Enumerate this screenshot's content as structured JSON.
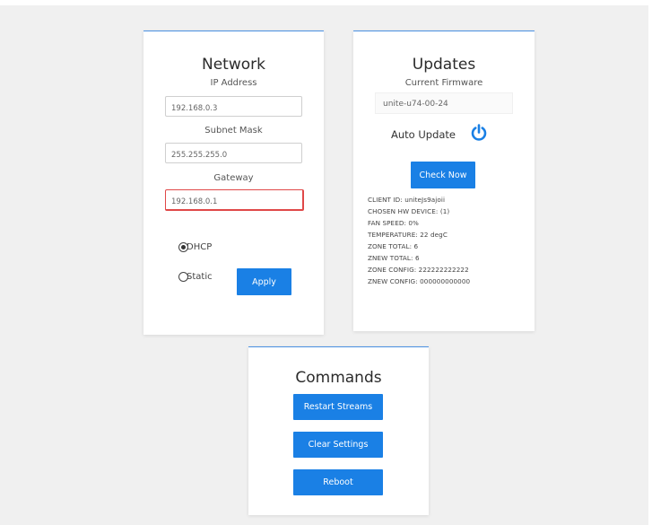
{
  "network": {
    "title": "Network",
    "ip_label": "IP Address",
    "ip_value": "192.168.0.3",
    "subnet_label": "Subnet Mask",
    "subnet_value": "255.255.255.0",
    "gateway_label": "Gateway",
    "gateway_value": "192.168.0.1",
    "dhcp_label": "DHCP",
    "static_label": "Static",
    "selected_mode": "DHCP",
    "apply_label": "Apply"
  },
  "updates": {
    "title": "Updates",
    "firmware_label": "Current Firmware",
    "firmware_value": "unite-u74-00-24",
    "auto_update_label": "Auto Update",
    "auto_update_icon": "power-icon",
    "check_now_label": "Check Now",
    "info": [
      "CLIENT ID: uniteJs9ajoii",
      "CHOSEN HW DEVICE: (1)",
      "FAN SPEED: 0%",
      "TEMPERATURE: 22 degC",
      "ZONE TOTAL: 6",
      "ZNEW TOTAL: 6",
      "ZONE CONFIG: 222222222222",
      "ZNEW CONFIG: 000000000000"
    ]
  },
  "commands": {
    "title": "Commands",
    "restart_label": "Restart Streams",
    "clear_label": "Clear Settings",
    "reboot_label": "Reboot"
  },
  "colors": {
    "accent": "#1a80e5",
    "card_border_top": "#4a90e2",
    "error_border": "#e04848",
    "background": "#f0f0f0"
  }
}
